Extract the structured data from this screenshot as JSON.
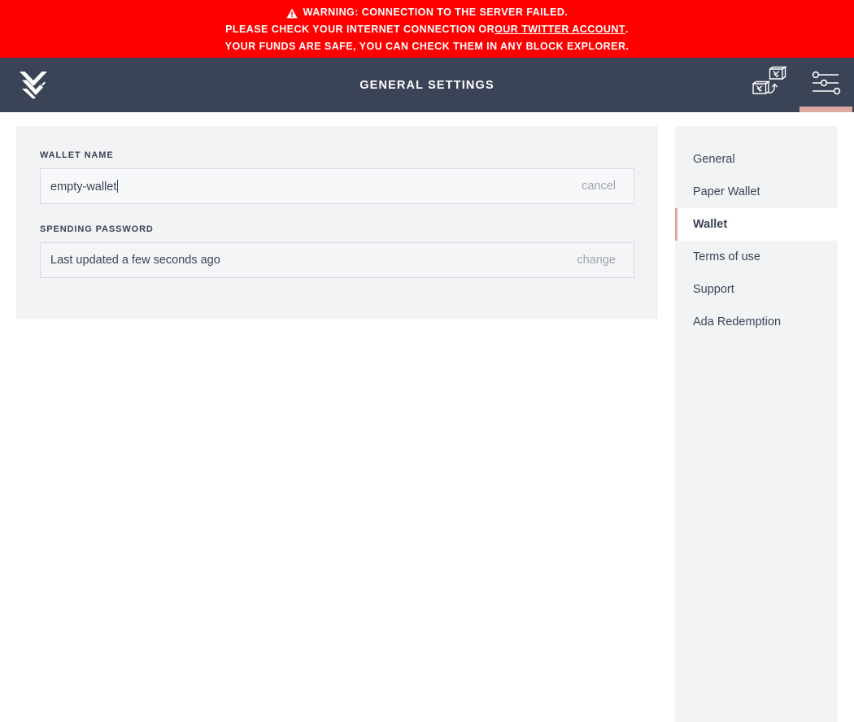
{
  "warning": {
    "icon": "warning-triangle-icon",
    "line1": "WARNING: CONNECTION TO THE SERVER FAILED.",
    "line2_before": "PLEASE CHECK YOUR INTERNET CONNECTION OR ",
    "line2_link": "OUR TWITTER ACCOUNT",
    "line2_after": ".",
    "line3": "YOUR FUNDS ARE SAFE, YOU CAN CHECK THEM IN ANY BLOCK EXPLORER.",
    "bg_color": "#ff0000",
    "text_color": "#ffffff"
  },
  "topbar": {
    "logo_icon": "daedalus-chevron-logo",
    "title": "GENERAL SETTINGS",
    "wallet_switch_icon": "wallet-switch-icon",
    "settings_icon": "settings-sliders-icon",
    "bg_color": "#3b4357",
    "active_indicator_color": "#dda8a0"
  },
  "main": {
    "wallet_name": {
      "label": "WALLET NAME",
      "value": "empty-wallet",
      "action": "cancel"
    },
    "spending_password": {
      "label": "SPENDING PASSWORD",
      "value": "Last updated a few seconds ago",
      "action": "change"
    },
    "panel_bg": "#f2f3f5"
  },
  "settings_menu": {
    "items": [
      {
        "label": "General",
        "active": false
      },
      {
        "label": "Paper Wallet",
        "active": false
      },
      {
        "label": "Wallet",
        "active": true
      },
      {
        "label": "Terms of use",
        "active": false
      },
      {
        "label": "Support",
        "active": false
      },
      {
        "label": "Ada Redemption",
        "active": false
      }
    ]
  }
}
